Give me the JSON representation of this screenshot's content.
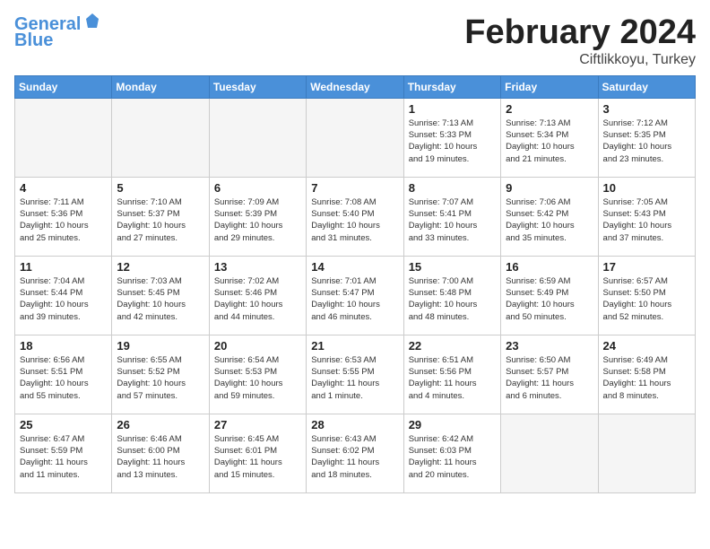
{
  "header": {
    "logo_line1": "General",
    "logo_line2": "Blue",
    "month": "February 2024",
    "location": "Ciftlikkoyu, Turkey"
  },
  "weekdays": [
    "Sunday",
    "Monday",
    "Tuesday",
    "Wednesday",
    "Thursday",
    "Friday",
    "Saturday"
  ],
  "weeks": [
    [
      {
        "day": "",
        "info": ""
      },
      {
        "day": "",
        "info": ""
      },
      {
        "day": "",
        "info": ""
      },
      {
        "day": "",
        "info": ""
      },
      {
        "day": "1",
        "info": "Sunrise: 7:13 AM\nSunset: 5:33 PM\nDaylight: 10 hours\nand 19 minutes."
      },
      {
        "day": "2",
        "info": "Sunrise: 7:13 AM\nSunset: 5:34 PM\nDaylight: 10 hours\nand 21 minutes."
      },
      {
        "day": "3",
        "info": "Sunrise: 7:12 AM\nSunset: 5:35 PM\nDaylight: 10 hours\nand 23 minutes."
      }
    ],
    [
      {
        "day": "4",
        "info": "Sunrise: 7:11 AM\nSunset: 5:36 PM\nDaylight: 10 hours\nand 25 minutes."
      },
      {
        "day": "5",
        "info": "Sunrise: 7:10 AM\nSunset: 5:37 PM\nDaylight: 10 hours\nand 27 minutes."
      },
      {
        "day": "6",
        "info": "Sunrise: 7:09 AM\nSunset: 5:39 PM\nDaylight: 10 hours\nand 29 minutes."
      },
      {
        "day": "7",
        "info": "Sunrise: 7:08 AM\nSunset: 5:40 PM\nDaylight: 10 hours\nand 31 minutes."
      },
      {
        "day": "8",
        "info": "Sunrise: 7:07 AM\nSunset: 5:41 PM\nDaylight: 10 hours\nand 33 minutes."
      },
      {
        "day": "9",
        "info": "Sunrise: 7:06 AM\nSunset: 5:42 PM\nDaylight: 10 hours\nand 35 minutes."
      },
      {
        "day": "10",
        "info": "Sunrise: 7:05 AM\nSunset: 5:43 PM\nDaylight: 10 hours\nand 37 minutes."
      }
    ],
    [
      {
        "day": "11",
        "info": "Sunrise: 7:04 AM\nSunset: 5:44 PM\nDaylight: 10 hours\nand 39 minutes."
      },
      {
        "day": "12",
        "info": "Sunrise: 7:03 AM\nSunset: 5:45 PM\nDaylight: 10 hours\nand 42 minutes."
      },
      {
        "day": "13",
        "info": "Sunrise: 7:02 AM\nSunset: 5:46 PM\nDaylight: 10 hours\nand 44 minutes."
      },
      {
        "day": "14",
        "info": "Sunrise: 7:01 AM\nSunset: 5:47 PM\nDaylight: 10 hours\nand 46 minutes."
      },
      {
        "day": "15",
        "info": "Sunrise: 7:00 AM\nSunset: 5:48 PM\nDaylight: 10 hours\nand 48 minutes."
      },
      {
        "day": "16",
        "info": "Sunrise: 6:59 AM\nSunset: 5:49 PM\nDaylight: 10 hours\nand 50 minutes."
      },
      {
        "day": "17",
        "info": "Sunrise: 6:57 AM\nSunset: 5:50 PM\nDaylight: 10 hours\nand 52 minutes."
      }
    ],
    [
      {
        "day": "18",
        "info": "Sunrise: 6:56 AM\nSunset: 5:51 PM\nDaylight: 10 hours\nand 55 minutes."
      },
      {
        "day": "19",
        "info": "Sunrise: 6:55 AM\nSunset: 5:52 PM\nDaylight: 10 hours\nand 57 minutes."
      },
      {
        "day": "20",
        "info": "Sunrise: 6:54 AM\nSunset: 5:53 PM\nDaylight: 10 hours\nand 59 minutes."
      },
      {
        "day": "21",
        "info": "Sunrise: 6:53 AM\nSunset: 5:55 PM\nDaylight: 11 hours\nand 1 minute."
      },
      {
        "day": "22",
        "info": "Sunrise: 6:51 AM\nSunset: 5:56 PM\nDaylight: 11 hours\nand 4 minutes."
      },
      {
        "day": "23",
        "info": "Sunrise: 6:50 AM\nSunset: 5:57 PM\nDaylight: 11 hours\nand 6 minutes."
      },
      {
        "day": "24",
        "info": "Sunrise: 6:49 AM\nSunset: 5:58 PM\nDaylight: 11 hours\nand 8 minutes."
      }
    ],
    [
      {
        "day": "25",
        "info": "Sunrise: 6:47 AM\nSunset: 5:59 PM\nDaylight: 11 hours\nand 11 minutes."
      },
      {
        "day": "26",
        "info": "Sunrise: 6:46 AM\nSunset: 6:00 PM\nDaylight: 11 hours\nand 13 minutes."
      },
      {
        "day": "27",
        "info": "Sunrise: 6:45 AM\nSunset: 6:01 PM\nDaylight: 11 hours\nand 15 minutes."
      },
      {
        "day": "28",
        "info": "Sunrise: 6:43 AM\nSunset: 6:02 PM\nDaylight: 11 hours\nand 18 minutes."
      },
      {
        "day": "29",
        "info": "Sunrise: 6:42 AM\nSunset: 6:03 PM\nDaylight: 11 hours\nand 20 minutes."
      },
      {
        "day": "",
        "info": ""
      },
      {
        "day": "",
        "info": ""
      }
    ]
  ]
}
